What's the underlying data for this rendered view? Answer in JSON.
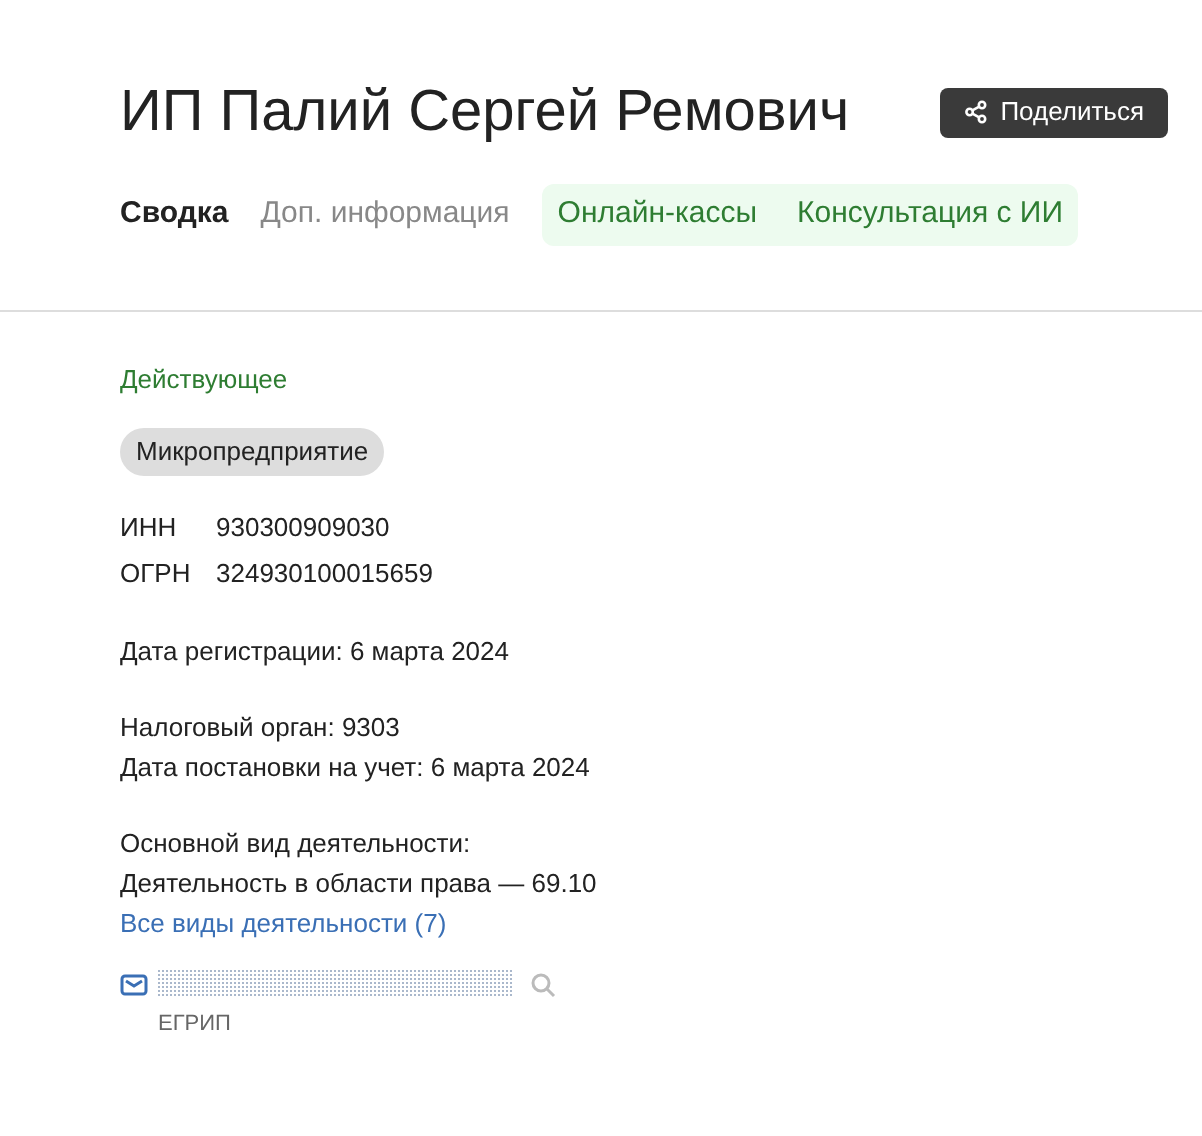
{
  "title": "ИП Палий Сергей Ремович",
  "share_button": {
    "label": "Поделиться"
  },
  "tabs": [
    {
      "label": "Сводка",
      "kind": "section",
      "selected": true
    },
    {
      "label": "Доп. информация",
      "kind": "section",
      "selected": false
    },
    {
      "label": "Онлайн-кассы",
      "kind": "service",
      "selected": false
    },
    {
      "label": "Консультация с ИИ",
      "kind": "service",
      "selected": false
    }
  ],
  "status": "Действующее",
  "badge": "Микропредприятие",
  "identifiers": [
    {
      "label": "ИНН",
      "value": "930300909030"
    },
    {
      "label": "ОГРН",
      "value": "324930100015659"
    }
  ],
  "registration_date": "Дата регистрации: 6 марта 2024",
  "tax": [
    "Налоговый орган: 9303",
    "Дата постановки на учет: 6 марта 2024"
  ],
  "activity": {
    "heading": "Основной вид деятельности:",
    "main": "Деятельность в области права — 69.10",
    "link": "Все виды деятельности (7)"
  },
  "email": {
    "source": "ЕГРИП"
  }
}
